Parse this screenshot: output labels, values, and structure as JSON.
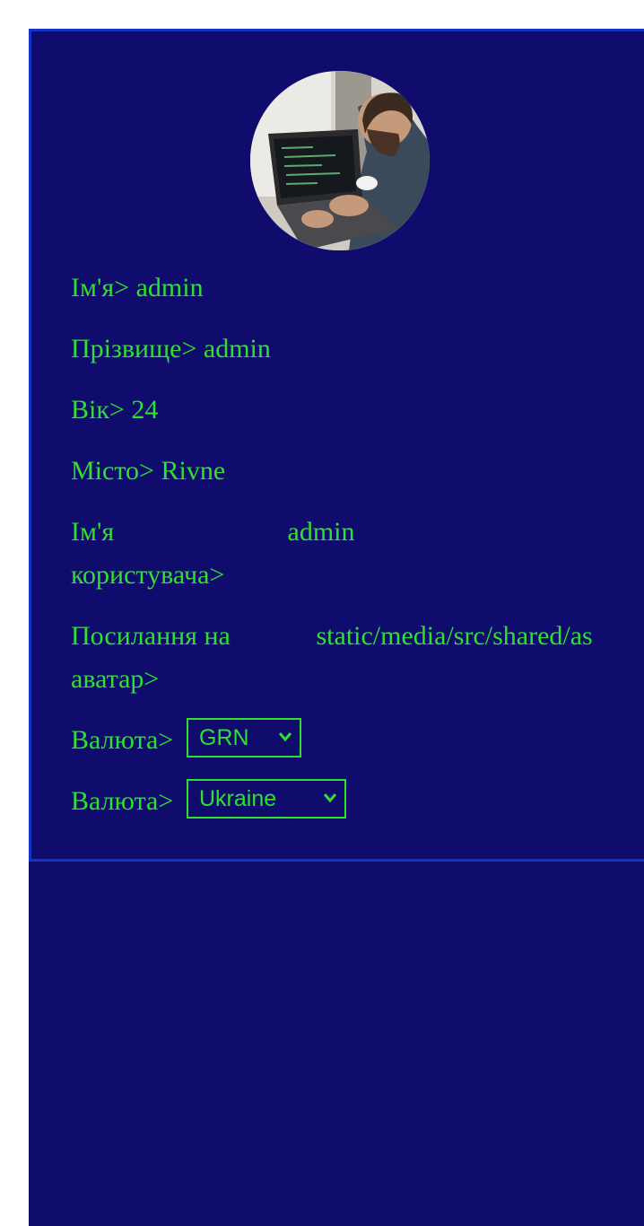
{
  "profile": {
    "fields": [
      {
        "label": "Ім'я>",
        "value": "admin"
      },
      {
        "label": "Прізвище>",
        "value": "admin"
      },
      {
        "label": "Вік>",
        "value": "24"
      },
      {
        "label": "Місто>",
        "value": "Rivne"
      }
    ],
    "username": {
      "label_line1": "Ім'я",
      "label_line2": "користувача>",
      "value": "admin"
    },
    "avatar_link": {
      "label_line1": "Посилання на",
      "label_line2": "аватар>",
      "value": "static/media/src/shared/as"
    },
    "currency": {
      "label": "Валюта>",
      "selected": "GRN"
    },
    "country": {
      "label": "Валюта>",
      "selected": "Ukraine"
    }
  },
  "colors": {
    "background": "#0f0c6e",
    "border": "#1433c8",
    "text": "#2fe02f"
  },
  "icons": {
    "avatar": "profile-photo",
    "select": "chevron-down-icon"
  }
}
